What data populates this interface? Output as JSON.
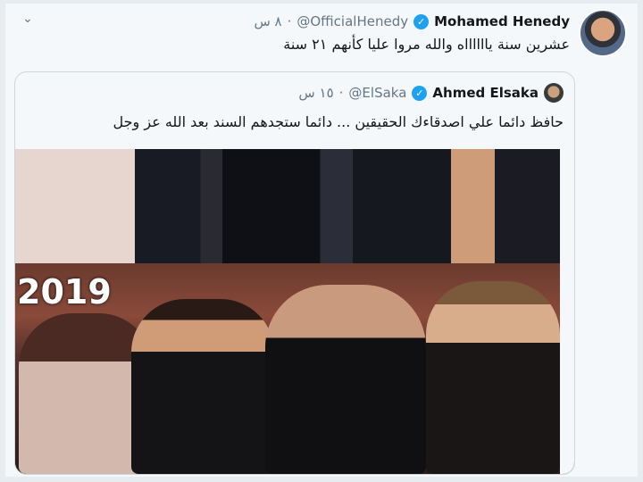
{
  "tweet": {
    "time": "٨ س",
    "dot": "·",
    "handle": "@OfficialHenedy",
    "name": "Mohamed Henedy",
    "text": "عشرين سنة يااااااه والله مروا عليا كأنهم ٢١ سنة"
  },
  "quoted": {
    "time": "١٥ س",
    "dot": "·",
    "handle": "@ElSaka",
    "name": "Ahmed Elsaka",
    "text": "حافظ دائما علي اصدقاءك الحقيقين ... دائما ستجدهم  السند بعد الله عز وجل",
    "photo_label": "2019"
  },
  "icons": {
    "menu": "chevron-down-icon",
    "verified": "verified-badge-icon"
  },
  "colors": {
    "accent": "#1da1f2",
    "secondary_text": "#657786",
    "background": "#f5f8fa"
  }
}
